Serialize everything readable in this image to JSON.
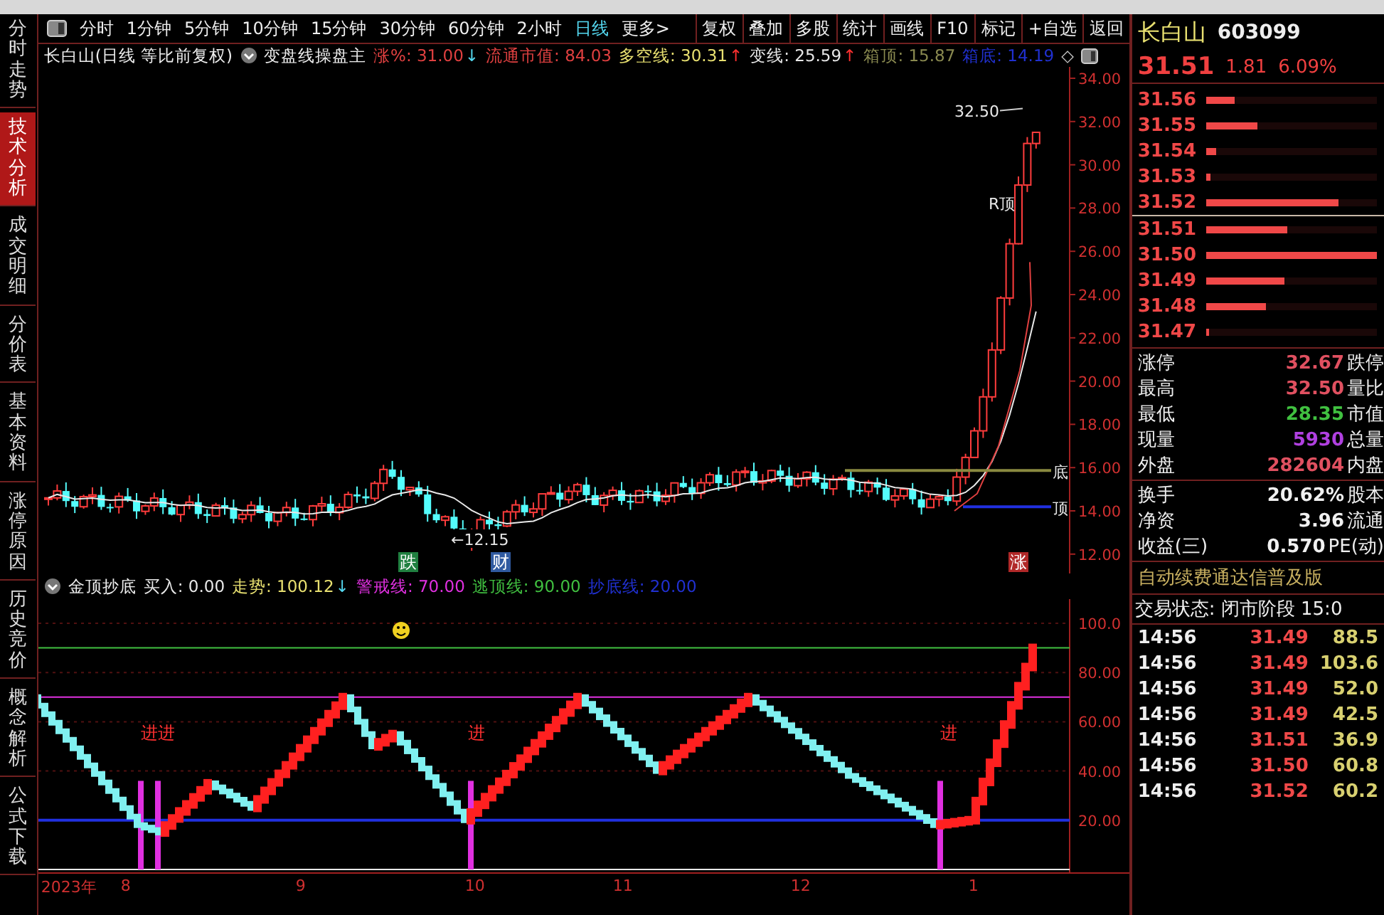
{
  "side_tabs": [
    {
      "label": "分时走势",
      "selected": false
    },
    {
      "label": "技术分析",
      "selected": true
    },
    {
      "label": "成交明细",
      "selected": false
    },
    {
      "label": "分价表",
      "selected": false
    },
    {
      "label": "基本资料",
      "selected": false
    },
    {
      "label": "涨停原因",
      "selected": false
    },
    {
      "label": "历史竞价",
      "selected": false
    },
    {
      "label": "概念解析",
      "selected": false
    },
    {
      "label": "公式下载",
      "selected": false
    }
  ],
  "toolbar": {
    "periods": [
      {
        "label": "分时",
        "selected": false
      },
      {
        "label": "1分钟",
        "selected": false
      },
      {
        "label": "5分钟",
        "selected": false
      },
      {
        "label": "10分钟",
        "selected": false
      },
      {
        "label": "15分钟",
        "selected": false
      },
      {
        "label": "30分钟",
        "selected": false
      },
      {
        "label": "60分钟",
        "selected": false
      },
      {
        "label": "2小时",
        "selected": false
      },
      {
        "label": "日线",
        "selected": true
      }
    ],
    "more": "更多>",
    "buttons": [
      "复权",
      "叠加",
      "多股",
      "统计",
      "画线",
      "F10",
      "标记",
      "+自选",
      "返回"
    ]
  },
  "chart_header": {
    "title": "长白山(日线 等比前复权)",
    "indicator": "变盘线操盘主",
    "values": [
      {
        "text": "涨%: 31.00",
        "color": "#e04040",
        "arrow": {
          "text": "↓",
          "kind": "down"
        }
      },
      {
        "text": "流通市值: 84.03",
        "color": "#e04040"
      },
      {
        "text": "多空线: 30.31",
        "color": "#e8e070",
        "arrow": {
          "text": "↑",
          "kind": "up"
        }
      },
      {
        "text": "变线: 25.59",
        "color": "#e8e8e8",
        "arrow": {
          "text": "↑",
          "kind": "up"
        }
      },
      {
        "text": "箱顶: 15.87",
        "color": "#8a8a50"
      },
      {
        "text": "箱底: 14.19",
        "color": "#2030d0"
      }
    ],
    "diamond": "◇"
  },
  "price_axis": [
    "34.00",
    "32.00",
    "30.00",
    "28.00",
    "26.00",
    "24.00",
    "22.00",
    "20.00",
    "18.00",
    "16.00",
    "14.00",
    "12.00"
  ],
  "chart_labels": {
    "high": "32.50",
    "low": "←12.15",
    "r_top": "R顶",
    "box_bottom": "底",
    "box_top": "顶",
    "marks": [
      {
        "text": "跌",
        "color": "#208040"
      },
      {
        "text": "财",
        "color": "#305aa0"
      },
      {
        "text": "涨",
        "color": "#b02828"
      }
    ]
  },
  "indicator_header": {
    "name": "金顶抄底",
    "values": [
      {
        "text": "买入: 0.00",
        "color": "#e8e8e8"
      },
      {
        "text": "走势: 100.12",
        "color": "#e8e070",
        "arrow": {
          "text": "↓",
          "kind": "down"
        }
      },
      {
        "text": "警戒线: 70.00",
        "color": "#e030e0"
      },
      {
        "text": "逃顶线: 90.00",
        "color": "#40c040"
      },
      {
        "text": "抄底线: 20.00",
        "color": "#2030d0"
      }
    ]
  },
  "indicator_axis": [
    "100.0",
    "80.00",
    "60.00",
    "40.00",
    "20.00"
  ],
  "entry_marks": [
    "进进",
    "进",
    "进"
  ],
  "date_axis": [
    "2023年",
    "8",
    "9",
    "10",
    "11",
    "12",
    "1"
  ],
  "quote": {
    "name": "长白山",
    "code": "603099",
    "price": "31.51",
    "change": "1.81",
    "percent": "6.09%"
  },
  "order_book": [
    {
      "price": "31.56",
      "level": 0.17
    },
    {
      "price": "31.55",
      "level": 0.3
    },
    {
      "price": "31.54",
      "level": 0.06
    },
    {
      "price": "31.53",
      "level": 0.03
    },
    {
      "price": "31.52",
      "level": 0.78
    },
    {
      "price": "31.51",
      "level": 0.48
    },
    {
      "price": "31.50",
      "level": 1.0
    },
    {
      "price": "31.49",
      "level": 0.46
    },
    {
      "price": "31.48",
      "level": 0.35
    },
    {
      "price": "31.47",
      "level": 0.02
    }
  ],
  "stats": [
    {
      "label": "涨停",
      "value": "32.67",
      "color": "#e05060",
      "label_2": "跌停"
    },
    {
      "label": "最高",
      "value": "32.50",
      "color": "#e05060",
      "label_2": "量比"
    },
    {
      "label": "最低",
      "value": "28.35",
      "color": "#40c040",
      "label_2": "市值"
    },
    {
      "label": "现量",
      "value": "5930",
      "color": "#b040e0",
      "label_2": "总量"
    },
    {
      "label": "外盘",
      "value": "282604",
      "color": "#e05060",
      "label_2": "内盘"
    }
  ],
  "stats_2": [
    {
      "label": "换手",
      "value": "20.62%",
      "color": "#f0f0f0",
      "label_2": "股本"
    },
    {
      "label": "净资",
      "value": "3.96",
      "color": "#f0f0f0",
      "label_2": "流通"
    },
    {
      "label": "收益(三)",
      "value": "0.570",
      "color": "#f0f0f0",
      "label_2": "PE(动)"
    }
  ],
  "promo": "自动续费通达信普及版",
  "trade_status": "交易状态: 闭市阶段 15:0",
  "ticks": [
    {
      "time": "14:56",
      "price": "31.49",
      "volume": "88.5"
    },
    {
      "time": "14:56",
      "price": "31.49",
      "volume": "103.6"
    },
    {
      "time": "14:56",
      "price": "31.49",
      "volume": "52.0"
    },
    {
      "time": "14:56",
      "price": "31.49",
      "volume": "42.5"
    },
    {
      "time": "14:56",
      "price": "31.51",
      "volume": "36.9"
    },
    {
      "time": "14:56",
      "price": "31.50",
      "volume": "60.8"
    },
    {
      "time": "14:56",
      "price": "31.52",
      "volume": "60.2"
    }
  ]
}
